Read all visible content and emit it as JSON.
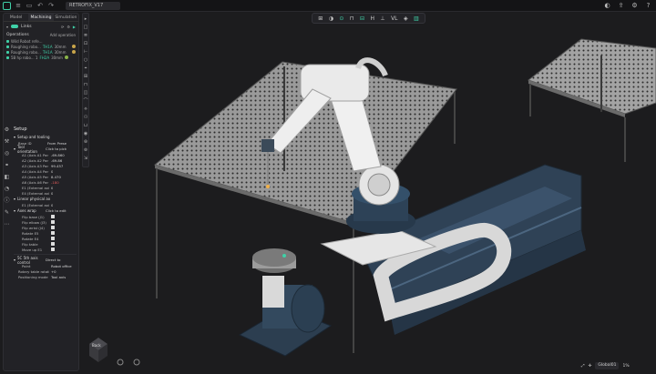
{
  "doc": {
    "name": "RETROFIX_V17"
  },
  "tabs": [
    {
      "label": "Model"
    },
    {
      "label": "Machining"
    },
    {
      "label": "Simulation"
    }
  ],
  "links": {
    "label": "Links"
  },
  "operations": {
    "header": "Operations",
    "add_label": "Add operation",
    "items": [
      {
        "name": "Wild Robot refe...",
        "time": ""
      },
      {
        "name": "Roughing robo...",
        "status": "TH1A",
        "time": "30mm"
      },
      {
        "name": "Roughing robo...",
        "status": "TH1A",
        "time": "30mm"
      },
      {
        "name": "5B hp robo... 1",
        "status": "FH2A",
        "time": "30mm"
      }
    ]
  },
  "setup": {
    "title": "Setup",
    "section_setup_tooling": "Setup and tooling",
    "base_id_label": "Base ID",
    "base_id_value": "From Prese",
    "tool_orientation_label": "Tool orientation",
    "tool_orientation_value": "Click to pick",
    "axes": [
      {
        "label": "A1 (Axis A1 Par",
        "value": "-69.860"
      },
      {
        "label": "A2 (Axis A2 Par",
        "value": "-69.86"
      },
      {
        "label": "A3 (Axis A3 Par",
        "value": "99.457"
      },
      {
        "label": "A4 (Axis A4 Par",
        "value": "0"
      },
      {
        "label": "A5 (Axis A5 Par",
        "value": "8.470"
      },
      {
        "label": "A6 (Axis A6 Par",
        "value": "-180",
        "red": true
      },
      {
        "label": "E1 (External axi",
        "value": "0"
      },
      {
        "label": "E4 (External axi",
        "value": "0"
      }
    ],
    "linear_physical_label": "Linear physical ax",
    "linear_e1_label": "E1 (External axi",
    "linear_e1_value": "0",
    "axes_wrap_label": "Axes wrap",
    "axes_wrap_value": "Click to edit",
    "flips": [
      {
        "label": "Flip base (J1)"
      },
      {
        "label": "Flip elbow (J3)"
      },
      {
        "label": "Flip wrist (J4)"
      },
      {
        "label": "Rotate E5"
      },
      {
        "label": "Rotate E4"
      },
      {
        "label": "Flip table"
      },
      {
        "label": "Move up E1"
      }
    ],
    "axis_control_label": "5C 5th axis control",
    "axis_control_value": "Direct to",
    "point_label": "Point",
    "point_value": "Robot office",
    "rotary_label": "Rotary table rotation",
    "rotary_value": "+0",
    "positioning_label": "Positioning mode",
    "positioning_value": "Tool axis"
  },
  "center_toolbar": {
    "items": [
      "⊞",
      "◑",
      "⊙",
      "⊓",
      "⊟",
      "H",
      "⊥",
      "VL",
      "◈",
      "▥"
    ]
  },
  "bottom": {
    "zoom": "Global01",
    "pct": "1%"
  },
  "viewcube": {
    "label": "Back"
  }
}
